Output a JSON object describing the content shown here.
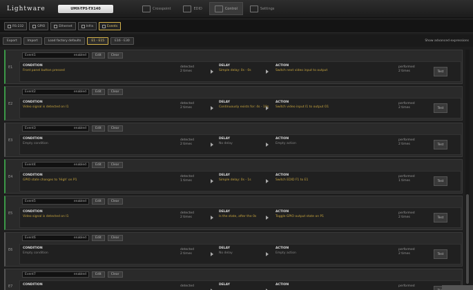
{
  "app": {
    "logo": "Lightware",
    "device": "UMX-TPS-TX140"
  },
  "topnav": [
    {
      "label": "Crosspoint",
      "active": false
    },
    {
      "label": "EDID",
      "active": false
    },
    {
      "label": "Control",
      "active": true
    },
    {
      "label": "Settings",
      "active": false
    }
  ],
  "subtabs": [
    {
      "label": "RS-232",
      "active": false
    },
    {
      "label": "GPIO",
      "active": false
    },
    {
      "label": "Ethernet",
      "active": false
    },
    {
      "label": "Infra",
      "active": false
    },
    {
      "label": "Events",
      "active": true
    }
  ],
  "toolbar": {
    "buttons": [
      {
        "label": "Export",
        "active": false
      },
      {
        "label": "Import",
        "active": false
      },
      {
        "label": "Load factory defaults",
        "active": false
      },
      {
        "label": "E1 - E15",
        "active": true
      },
      {
        "label": "E16 - E30",
        "active": false
      }
    ],
    "show_advanced": "Show advanced expressions"
  },
  "labels": {
    "condition": "CONDITION",
    "delay": "DELAY",
    "action": "ACTION",
    "edit": "Edit",
    "clear": "Clear",
    "test": "Test",
    "enabled": "enabled"
  },
  "events": [
    {
      "num": "E1",
      "name": "Event1",
      "enabled": true,
      "condition": "Front panel button pressed",
      "detected": "detected",
      "det_count": "2 times",
      "delay": "Simple delay: 0s - 0s",
      "action": "Switch next video input to output",
      "performed": "performed",
      "perf_count": "2 times",
      "empty": false
    },
    {
      "num": "E2",
      "name": "Event2",
      "enabled": true,
      "condition": "Video signal is detected on I1",
      "detected": "detected",
      "det_count": "2 times",
      "delay": "Continuously exists for: 4s - 10s",
      "action": "Switch video input I1 to output O1",
      "performed": "performed",
      "perf_count": "2 times",
      "empty": false
    },
    {
      "num": "E3",
      "name": "Event3",
      "enabled": false,
      "condition": "Empty condition",
      "detected": "detected",
      "det_count": "2 times",
      "delay": "No delay",
      "action": "Empty action",
      "performed": "performed",
      "perf_count": "2 times",
      "empty": true
    },
    {
      "num": "E4",
      "name": "Event4",
      "enabled": true,
      "condition": "GPIO state changes to 'High' on P1",
      "detected": "detected",
      "det_count": "1 times",
      "delay": "Simple delay: 0s - 1s",
      "action": "Switch EDID F1 to E1",
      "performed": "performed",
      "perf_count": "1 times",
      "empty": false
    },
    {
      "num": "E5",
      "name": "Event5",
      "enabled": true,
      "condition": "Video signal is detected on I1",
      "detected": "detected",
      "det_count": "2 times",
      "delay": "Is the state, after the 0s",
      "action": "Toggle GPIO output state on P1",
      "performed": "performed",
      "perf_count": "2 times",
      "empty": false
    },
    {
      "num": "E6",
      "name": "Event6",
      "enabled": false,
      "condition": "Empty condition",
      "detected": "detected",
      "det_count": "2 times",
      "delay": "No delay",
      "action": "Empty action",
      "performed": "performed",
      "perf_count": "2 times",
      "empty": true
    },
    {
      "num": "E7",
      "name": "Event7",
      "enabled": false,
      "condition": "",
      "detected": "detected",
      "det_count": "",
      "delay": "",
      "action": "",
      "performed": "performed",
      "perf_count": "",
      "empty": true
    }
  ]
}
